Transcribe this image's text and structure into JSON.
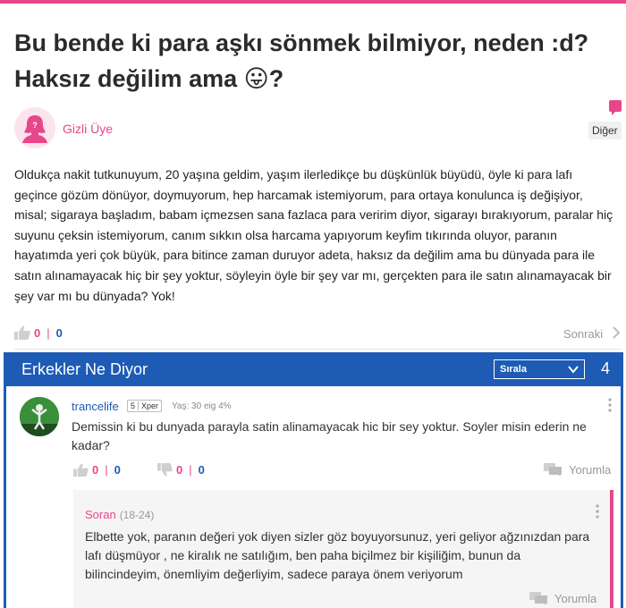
{
  "question": {
    "title": "Bu bende ki para aşkı sönmek bilmiyor, neden :d? Haksız değilim ama 😛?",
    "author": "Gizli Üye",
    "category": "Diğer",
    "body": "Oldukça nakit tutkunuyum, 20 yaşına geldim, yaşım ilerledikçe bu düşkünlük büyüdü, öyle ki para lafı geçince gözüm dönüyor, doymuyorum, hep harcamak istemiyorum, para ortaya konulunca iş değişiyor, misal; sigaraya başladım, babam içmezsen sana fazlaca para veririm diyor, sigarayı bırakıyorum, paralar hiç suyunu çeksin istemiyorum, canım sıkkın olsa harcama yapıyorum keyfim tıkırında oluyor, paranın hayatımda yeri çok büyük, para bitince zaman duruyor adeta, haksız da değilim ama bu dünyada para ile satın alınamayacak hiç bir şey yoktur, söyleyin öyle bir şey var mı, gerçekten para ile satın alınamayacak bir şey var mı bu dünyada? Yok!",
    "likes": "0",
    "dislikes": "0",
    "next_label": "Sonraki"
  },
  "answers_panel": {
    "title": "Erkekler Ne Diyor",
    "sort_label": "Sırala",
    "count": "4"
  },
  "answer": {
    "username": "trancelife",
    "level": "5",
    "badge": "Xper",
    "meta": "Yaş: 30 eig 4%",
    "text": "Demissin ki bu dunyada parayla satin alinamayacak hic bir sey yoktur. Soyler misin ederin ne kadar?",
    "likes": "0",
    "likes_neg": "0",
    "dislikes": "0",
    "dislikes_neg": "0",
    "reply_label": "Yorumla"
  },
  "comment": {
    "author": "Soran",
    "age": "(18-24)",
    "text": "Elbette yok, paranın değeri yok diyen sizler göz boyuyorsunuz, yeri geliyor ağzınızdan para lafı düşmüyor , ne kiralık ne satılığım, ben paha biçilmez bir kişiliğim, bunun da bilincindeyim, önemliyim değerliyim, sadece paraya önem veriyorum",
    "reply_label": "Yorumla"
  },
  "colors": {
    "accent_pink": "#e8468a",
    "panel_blue": "#1d5bb5"
  },
  "icons": [
    "thumbs-up-icon",
    "thumbs-down-icon",
    "chevron-right-icon",
    "chevron-down-icon",
    "kebab-menu-icon",
    "comment-icon",
    "flag-icon",
    "female-avatar-icon"
  ]
}
